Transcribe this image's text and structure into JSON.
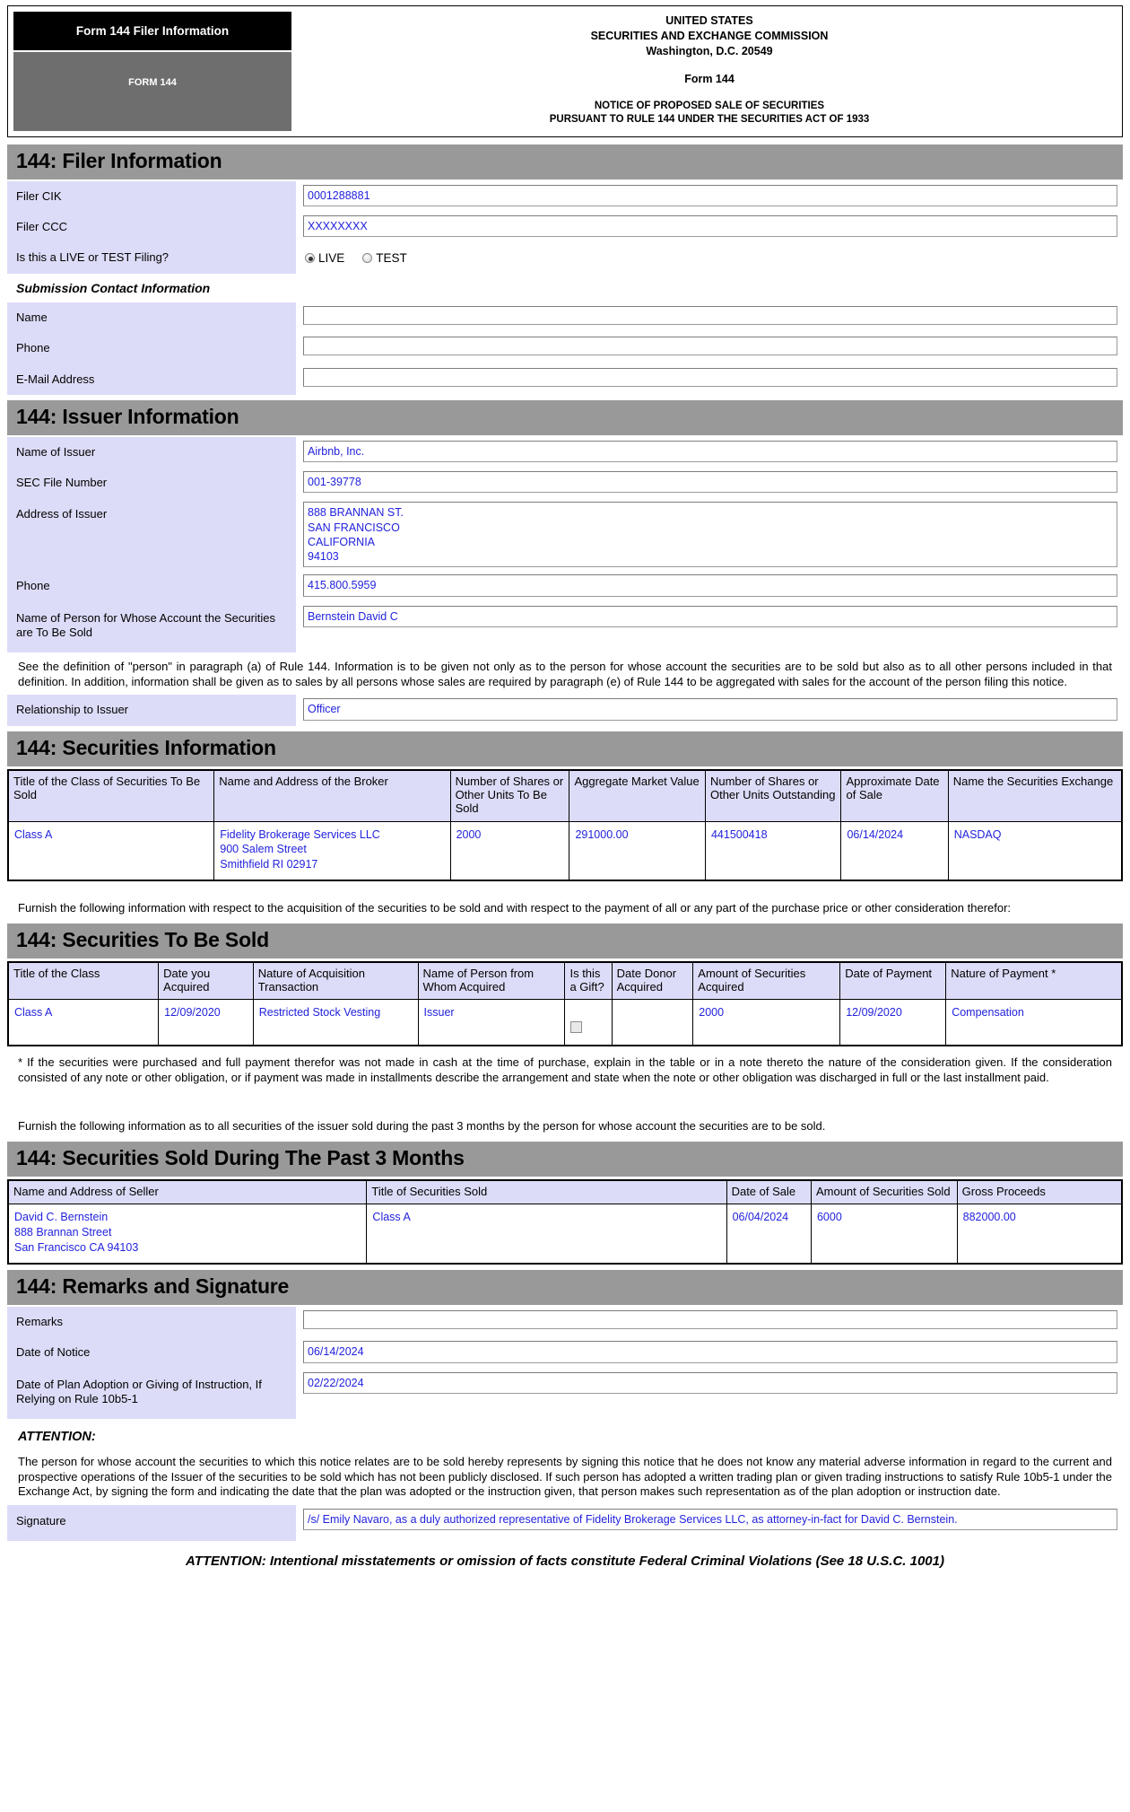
{
  "masthead": {
    "badge_top": "Form 144 Filer Information",
    "badge_bottom": "FORM 144",
    "agency_line1": "UNITED STATES",
    "agency_line2": "SECURITIES AND EXCHANGE COMMISSION",
    "agency_line3": "Washington, D.C. 20549",
    "form_name": "Form 144",
    "notice_line1": "NOTICE OF PROPOSED SALE OF SECURITIES",
    "notice_line2": "PURSUANT TO RULE 144 UNDER THE SECURITIES ACT OF 1933"
  },
  "sections": {
    "filer": "144: Filer Information",
    "issuer": "144: Issuer Information",
    "securities_info": "144: Securities Information",
    "securities_to_be_sold": "144: Securities To Be Sold",
    "sold_past_3_months": "144: Securities Sold During The Past 3 Months",
    "remarks_signature": "144: Remarks and Signature"
  },
  "filer": {
    "cik_label": "Filer CIK",
    "cik_value": "0001288881",
    "ccc_label": "Filer CCC",
    "ccc_value": "XXXXXXXX",
    "live_test_label": "Is this a LIVE or TEST Filing?",
    "live_option": "LIVE",
    "test_option": "TEST",
    "selected_filing_type": "LIVE",
    "contact_subhead": "Submission Contact Information",
    "contact_name_label": "Name",
    "contact_name_value": "",
    "contact_phone_label": "Phone",
    "contact_phone_value": "",
    "contact_email_label": "E-Mail Address",
    "contact_email_value": ""
  },
  "issuer": {
    "name_label": "Name of Issuer",
    "name_value": "Airbnb, Inc.",
    "sec_file_label": "SEC File Number",
    "sec_file_value": "001-39778",
    "address_label": "Address of Issuer",
    "address_value": "888 BRANNAN ST.\nSAN FRANCISCO\nCALIFORNIA\n94103",
    "phone_label": "Phone",
    "phone_value": "415.800.5959",
    "person_label": "Name of Person for Whose Account the Securities are To Be Sold",
    "person_value": "Bernstein David C",
    "definition_note": "See the definition of \"person\" in paragraph (a) of Rule 144. Information is to be given not only as to the person for whose account the securities are to be sold but also as to all other persons included in that definition. In addition, information shall be given as to sales by all persons whose sales are required by paragraph (e) of Rule 144 to be aggregated with sales for the account of the person filing this notice.",
    "relationship_label": "Relationship to Issuer",
    "relationship_value": "Officer"
  },
  "securities_information": {
    "headers": [
      "Title of the Class of Securities To Be Sold",
      "Name and Address of the Broker",
      "Number of Shares or Other Units To Be Sold",
      "Aggregate Market Value",
      "Number of Shares or Other Units Outstanding",
      "Approximate Date of Sale",
      "Name the Securities Exchange"
    ],
    "rows": [
      {
        "title_class": "Class A",
        "broker": "Fidelity Brokerage Services LLC\n900 Salem Street\nSmithfield   RI   02917",
        "units_to_be_sold": "2000",
        "aggregate_market_value": "291000.00",
        "units_outstanding": "441500418",
        "approx_date_of_sale": "06/14/2024",
        "exchange": "NASDAQ"
      }
    ],
    "furnish_note": "Furnish the following information with respect to the acquisition of the securities to be sold and with respect to the payment of all or any part of the purchase price or other consideration therefor:"
  },
  "securities_to_be_sold": {
    "headers": [
      "Title of the Class",
      "Date you Acquired",
      "Nature of Acquisition Transaction",
      "Name of Person from Whom Acquired",
      "Is this a Gift?",
      "Date Donor Acquired",
      "Amount of Securities Acquired",
      "Date of Payment",
      "Nature of Payment *"
    ],
    "rows": [
      {
        "title_class": "Class A",
        "date_acquired": "12/09/2020",
        "nature_of_acquisition": "Restricted Stock Vesting",
        "person_from_whom": "Issuer",
        "is_gift": false,
        "date_donor_acquired": "",
        "amount_acquired": "2000",
        "date_of_payment": "12/09/2020",
        "nature_of_payment": "Compensation"
      }
    ],
    "footnote": "* If the securities were purchased and full payment therefor was not made in cash at the time of purchase, explain in the table or in a note thereto the nature of the consideration given. If the consideration consisted of any note or other obligation, or if payment was made in installments describe the arrangement and state when the note or other obligation was discharged in full or the last installment paid.",
    "furnish_note_2": "Furnish the following information as to all securities of the issuer sold during the past 3 months by the person for whose account the securities are to be sold."
  },
  "securities_sold_past_3_months": {
    "headers": [
      "Name and Address of Seller",
      "Title of Securities Sold",
      "Date of Sale",
      "Amount of Securities Sold",
      "Gross Proceeds"
    ],
    "rows": [
      {
        "seller": "David C. Bernstein\n888 Brannan Street\nSan Francisco   CA   94103",
        "title_sold": "Class A",
        "date_of_sale": "06/04/2024",
        "amount_sold": "6000",
        "gross_proceeds": "882000.00"
      }
    ]
  },
  "remarks": {
    "remarks_label": "Remarks",
    "remarks_value": "",
    "date_of_notice_label": "Date of Notice",
    "date_of_notice_value": "06/14/2024",
    "date_of_plan_label": "Date of Plan Adoption or Giving of Instruction, If Relying on Rule 10b5-1",
    "date_of_plan_value": "02/22/2024",
    "attention_label": "ATTENTION:",
    "attention_body": "The person for whose account the securities to which this notice relates are to be sold hereby represents by signing this notice that he does not know any material adverse information in regard to the current and prospective operations of the Issuer of the securities to be sold which has not been publicly disclosed. If such person has adopted a written trading plan or given trading instructions to satisfy Rule 10b5-1 under the Exchange Act, by signing the form and indicating the date that the plan was adopted or the instruction given, that person makes such representation as of the plan adoption or instruction date.",
    "signature_label": "Signature",
    "signature_value": "/s/ Emily Navaro, as a duly authorized representative of Fidelity Brokerage Services LLC, as attorney-in-fact for David C. Bernstein.",
    "footer_warning": "ATTENTION: Intentional misstatements or omission of facts constitute Federal Criminal Violations (See 18 U.S.C. 1001)"
  }
}
